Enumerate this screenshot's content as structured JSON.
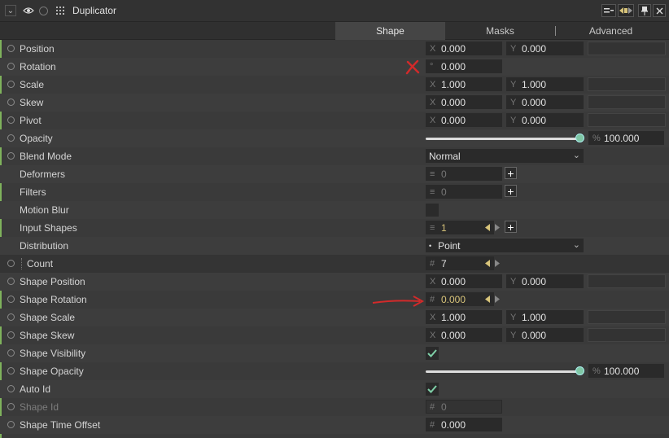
{
  "header": {
    "title": "Duplicator"
  },
  "tabs": [
    {
      "label": "Shape",
      "active": true
    },
    {
      "label": "Masks",
      "active": false
    },
    {
      "label": "Advanced",
      "active": false
    }
  ],
  "rows": {
    "position": {
      "label": "Position",
      "x": "0.000",
      "y": "0.000"
    },
    "rotation": {
      "label": "Rotation",
      "prefix": "°",
      "value": "0.000"
    },
    "scale": {
      "label": "Scale",
      "x": "1.000",
      "y": "1.000"
    },
    "skew": {
      "label": "Skew",
      "x": "0.000",
      "y": "0.000"
    },
    "pivot": {
      "label": "Pivot",
      "x": "0.000",
      "y": "0.000"
    },
    "opacity": {
      "label": "Opacity",
      "prefix": "%",
      "value": "100.000",
      "level": 1.0
    },
    "blend_mode": {
      "label": "Blend Mode",
      "value": "Normal"
    },
    "deformers": {
      "label": "Deformers",
      "value": "0"
    },
    "filters": {
      "label": "Filters",
      "value": "0"
    },
    "motion_blur": {
      "label": "Motion Blur",
      "checked": false
    },
    "input_shapes": {
      "label": "Input Shapes",
      "value": "1"
    },
    "distribution": {
      "label": "Distribution",
      "value": "Point"
    },
    "count": {
      "label": "Count",
      "prefix": "#",
      "value": "7"
    },
    "shape_position": {
      "label": "Shape Position",
      "x": "0.000",
      "y": "0.000"
    },
    "shape_rotation": {
      "label": "Shape Rotation",
      "prefix": "#",
      "value": "0.000"
    },
    "shape_scale": {
      "label": "Shape Scale",
      "x": "1.000",
      "y": "1.000"
    },
    "shape_skew": {
      "label": "Shape Skew",
      "x": "0.000",
      "y": "0.000"
    },
    "shape_visibility": {
      "label": "Shape Visibility",
      "checked": true
    },
    "shape_opacity": {
      "label": "Shape Opacity",
      "prefix": "%",
      "value": "100.000",
      "level": 1.0
    },
    "auto_id": {
      "label": "Auto Id",
      "checked": true
    },
    "shape_id": {
      "label": "Shape Id",
      "prefix": "#",
      "value": "0"
    },
    "shape_time_offset": {
      "label": "Shape Time Offset",
      "prefix": "#",
      "value": "0.000"
    }
  },
  "axis_labels": {
    "x": "X",
    "y": "Y"
  },
  "colors": {
    "accent_green": "#7fb25c",
    "slider_knob": "#7fc6a4",
    "annotation_red": "#d22a2a",
    "animated_value": "#d8c47a"
  }
}
